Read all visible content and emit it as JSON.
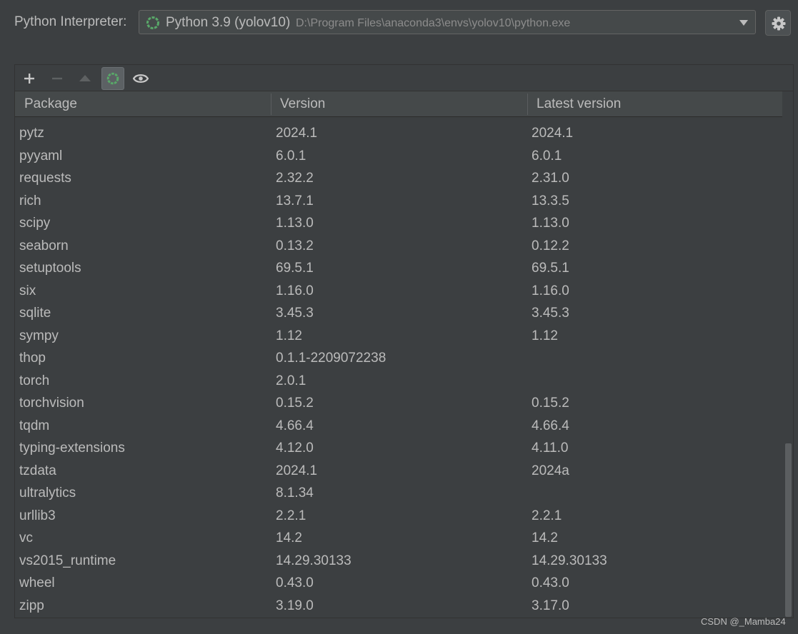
{
  "interpreter": {
    "label": "Python Interpreter:",
    "selected_name": "Python 3.9 (yolov10)",
    "selected_path": "D:\\Program Files\\anaconda3\\envs\\yolov10\\python.exe"
  },
  "toolbar": {
    "buttons": [
      "add-icon",
      "remove-icon",
      "upgrade-icon",
      "refresh-icon",
      "show-early-releases-icon"
    ],
    "active": "refresh-icon"
  },
  "table": {
    "columns": [
      "Package",
      "Version",
      "Latest version"
    ],
    "rows": [
      [
        "pytz",
        "2024.1",
        "2024.1"
      ],
      [
        "pyyaml",
        "6.0.1",
        "6.0.1"
      ],
      [
        "requests",
        "2.32.2",
        "2.31.0"
      ],
      [
        "rich",
        "13.7.1",
        "13.3.5"
      ],
      [
        "scipy",
        "1.13.0",
        "1.13.0"
      ],
      [
        "seaborn",
        "0.13.2",
        "0.12.2"
      ],
      [
        "setuptools",
        "69.5.1",
        "69.5.1"
      ],
      [
        "six",
        "1.16.0",
        "1.16.0"
      ],
      [
        "sqlite",
        "3.45.3",
        "3.45.3"
      ],
      [
        "sympy",
        "1.12",
        "1.12"
      ],
      [
        "thop",
        "0.1.1-2209072238",
        ""
      ],
      [
        "torch",
        "2.0.1",
        ""
      ],
      [
        "torchvision",
        "0.15.2",
        "0.15.2"
      ],
      [
        "tqdm",
        "4.66.4",
        "4.66.4"
      ],
      [
        "typing-extensions",
        "4.12.0",
        "4.11.0"
      ],
      [
        "tzdata",
        "2024.1",
        "2024a"
      ],
      [
        "ultralytics",
        "8.1.34",
        ""
      ],
      [
        "urllib3",
        "2.2.1",
        "2.2.1"
      ],
      [
        "vc",
        "14.2",
        "14.2"
      ],
      [
        "vs2015_runtime",
        "14.29.30133",
        "14.29.30133"
      ],
      [
        "wheel",
        "0.43.0",
        "0.43.0"
      ],
      [
        "zipp",
        "3.19.0",
        "3.17.0"
      ]
    ]
  },
  "watermark": "CSDN @_Mamba24",
  "colors": {
    "background": "#3c3f41",
    "text": "#bbbbbb",
    "path_text": "#8c8c8c",
    "spinner_green": "#59a869",
    "header_bg": "#45494a"
  }
}
